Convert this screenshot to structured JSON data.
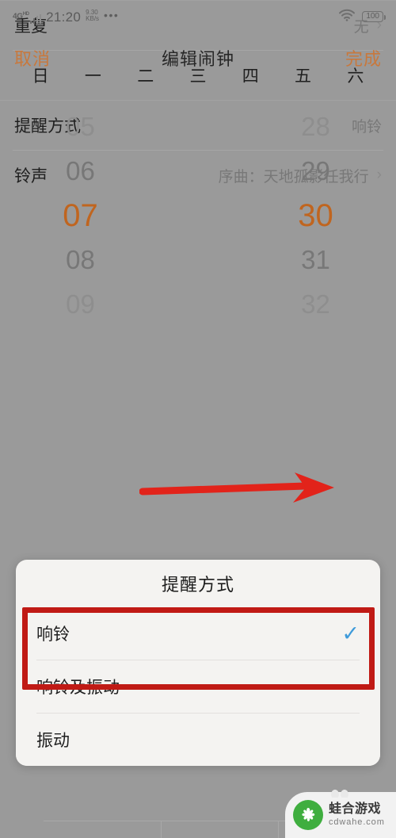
{
  "status_bar": {
    "network_type": "4G",
    "network_sup": "HD",
    "time": "21:20",
    "speed_value": "9.30",
    "speed_unit": "KB/s",
    "overflow_dots": "•••",
    "wifi_icon": "wifi-icon",
    "battery_level": "100"
  },
  "nav": {
    "cancel_label": "取消",
    "title": "编辑闹钟",
    "done_label": "完成",
    "accent_color": "#c8783c"
  },
  "time_picker": {
    "hours": [
      "05",
      "06",
      "07",
      "08",
      "09"
    ],
    "selected_hour": "07",
    "minutes": [
      "28",
      "29",
      "30",
      "31",
      "32"
    ],
    "selected_minute": "30",
    "selected_color": "#c0651f"
  },
  "settings": {
    "repeat": {
      "label": "重复",
      "value": "无",
      "chevron": "›"
    },
    "weekdays": [
      "日",
      "一",
      "二",
      "三",
      "四",
      "五",
      "六"
    ],
    "reminder": {
      "label": "提醒方式",
      "value": "响铃"
    },
    "ringtone": {
      "label": "铃声",
      "value": "序曲：天地孤影任我行",
      "chevron": "›"
    }
  },
  "annotation": {
    "arrow_color": "#e2231a",
    "highlight_box_color": "#c01a15"
  },
  "dialog": {
    "title": "提醒方式",
    "options": [
      {
        "label": "响铃",
        "checked": true,
        "check_glyph": "✓"
      },
      {
        "label": "响铃及振动",
        "checked": false
      },
      {
        "label": "振动",
        "checked": false
      }
    ],
    "check_color": "#3d9ada"
  },
  "watermark": {
    "name": "蛙合游戏",
    "url": "cdwahe.com",
    "logo_icon": "frog-logo-icon",
    "logo_color": "#3fae3f"
  }
}
